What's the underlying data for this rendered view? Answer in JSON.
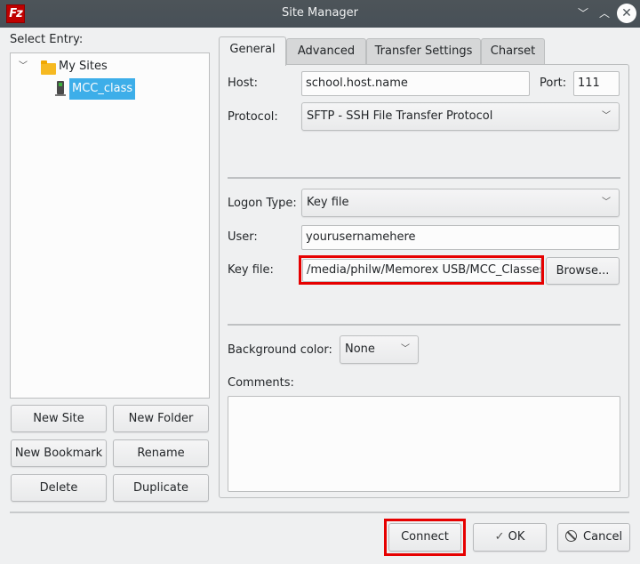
{
  "window": {
    "title": "Site Manager",
    "app_icon_text": "Fz",
    "minimize_glyph": "﹀",
    "maximize_glyph": "︿",
    "close_glyph": "✕"
  },
  "left": {
    "select_entry_label": "Select Entry:",
    "tree": {
      "expander_glyph": "﹀",
      "folder": "My Sites",
      "sites": [
        {
          "name": "MCC_class",
          "selected": true
        }
      ]
    },
    "buttons": {
      "new_site": "New Site",
      "new_folder": "New Folder",
      "new_bookmark": "New Bookmark",
      "rename": "Rename",
      "delete": "Delete",
      "duplicate": "Duplicate"
    }
  },
  "tabs": [
    {
      "label": "General",
      "active": true
    },
    {
      "label": "Advanced",
      "active": false
    },
    {
      "label": "Transfer Settings",
      "active": false
    },
    {
      "label": "Charset",
      "active": false
    }
  ],
  "general": {
    "host_label": "Host:",
    "host_value": "school.host.name",
    "port_label": "Port:",
    "port_value": "111",
    "protocol_label": "Protocol:",
    "protocol_value": "SFTP - SSH File Transfer Protocol",
    "logon_type_label": "Logon Type:",
    "logon_type_value": "Key file",
    "user_label": "User:",
    "user_value": "yourusernamehere",
    "key_file_label": "Key file:",
    "key_file_value": "/media/philw/Memorex USB/MCC_Classes",
    "browse_label": "Browse...",
    "background_color_label": "Background color:",
    "background_color_value": "None",
    "comments_label": "Comments:",
    "comments_value": "",
    "dropdown_glyph": "﹀"
  },
  "footer": {
    "connect": "Connect",
    "ok": "OK",
    "ok_glyph": "✓",
    "cancel": "Cancel",
    "cancel_glyph": "⃠"
  },
  "colors": {
    "selection": "#3daee9",
    "highlight_box": "#e60000",
    "titlebar": "#4d5459"
  }
}
